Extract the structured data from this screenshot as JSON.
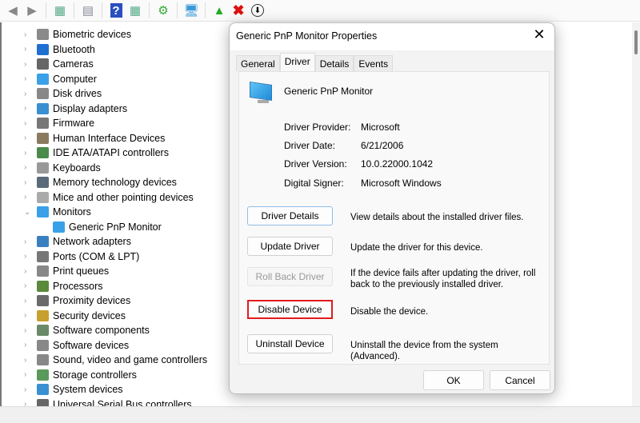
{
  "toolbar": {
    "icons": [
      "back-arrow-icon",
      "forward-arrow-icon",
      "show-hide-console-tree-icon",
      "properties-icon",
      "help-icon",
      "action-pane-icon",
      "update-driver-icon",
      "scan-hardware-changes-icon",
      "enable-device-icon",
      "uninstall-device-icon",
      "disable-device-icon"
    ]
  },
  "tree": [
    {
      "label": "Biometric devices",
      "color": "#8a8a8a"
    },
    {
      "label": "Bluetooth",
      "color": "#1f6fd1"
    },
    {
      "label": "Cameras",
      "color": "#666"
    },
    {
      "label": "Computer",
      "color": "#3aa0e8"
    },
    {
      "label": "Disk drives",
      "color": "#888"
    },
    {
      "label": "Display adapters",
      "color": "#3a8fd0"
    },
    {
      "label": "Firmware",
      "color": "#777"
    },
    {
      "label": "Human Interface Devices",
      "color": "#8a7a60"
    },
    {
      "label": "IDE ATA/ATAPI controllers",
      "color": "#4a8a4a"
    },
    {
      "label": "Keyboards",
      "color": "#999"
    },
    {
      "label": "Memory technology devices",
      "color": "#5a6a7a"
    },
    {
      "label": "Mice and other pointing devices",
      "color": "#aaa"
    },
    {
      "label": "Monitors",
      "color": "#3aa0e8",
      "expanded": true
    },
    {
      "label": "Generic PnP Monitor",
      "color": "#3aa0e8",
      "child": true
    },
    {
      "label": "Network adapters",
      "color": "#3a80c0"
    },
    {
      "label": "Ports (COM & LPT)",
      "color": "#777"
    },
    {
      "label": "Print queues",
      "color": "#888"
    },
    {
      "label": "Processors",
      "color": "#5a8a3a"
    },
    {
      "label": "Proximity devices",
      "color": "#6a6a6a"
    },
    {
      "label": "Security devices",
      "color": "#c8a030"
    },
    {
      "label": "Software components",
      "color": "#6a8a6a"
    },
    {
      "label": "Software devices",
      "color": "#888"
    },
    {
      "label": "Sound, video and game controllers",
      "color": "#888"
    },
    {
      "label": "Storage controllers",
      "color": "#5a9a5a"
    },
    {
      "label": "System devices",
      "color": "#3a90d0"
    },
    {
      "label": "Universal Serial Bus controllers",
      "color": "#666"
    }
  ],
  "dialog": {
    "title": "Generic PnP Monitor Properties",
    "tabs": [
      "General",
      "Driver",
      "Details",
      "Events"
    ],
    "active_tab": "Driver",
    "device_name": "Generic PnP Monitor",
    "fields": [
      {
        "label": "Driver Provider:",
        "value": "Microsoft"
      },
      {
        "label": "Driver Date:",
        "value": "6/21/2006"
      },
      {
        "label": "Driver Version:",
        "value": "10.0.22000.1042"
      },
      {
        "label": "Digital Signer:",
        "value": "Microsoft Windows"
      }
    ],
    "actions": [
      {
        "button": "Driver Details",
        "desc": "View details about the installed driver files."
      },
      {
        "button": "Update Driver",
        "desc": "Update the driver for this device."
      },
      {
        "button": "Roll Back Driver",
        "desc": "If the device fails after updating the driver, roll back to the previously installed driver.",
        "disabled": true
      },
      {
        "button": "Disable Device",
        "desc": "Disable the device.",
        "highlighted": true
      },
      {
        "button": "Uninstall Device",
        "desc": "Uninstall the device from the system (Advanced)."
      }
    ],
    "ok": "OK",
    "cancel": "Cancel"
  }
}
